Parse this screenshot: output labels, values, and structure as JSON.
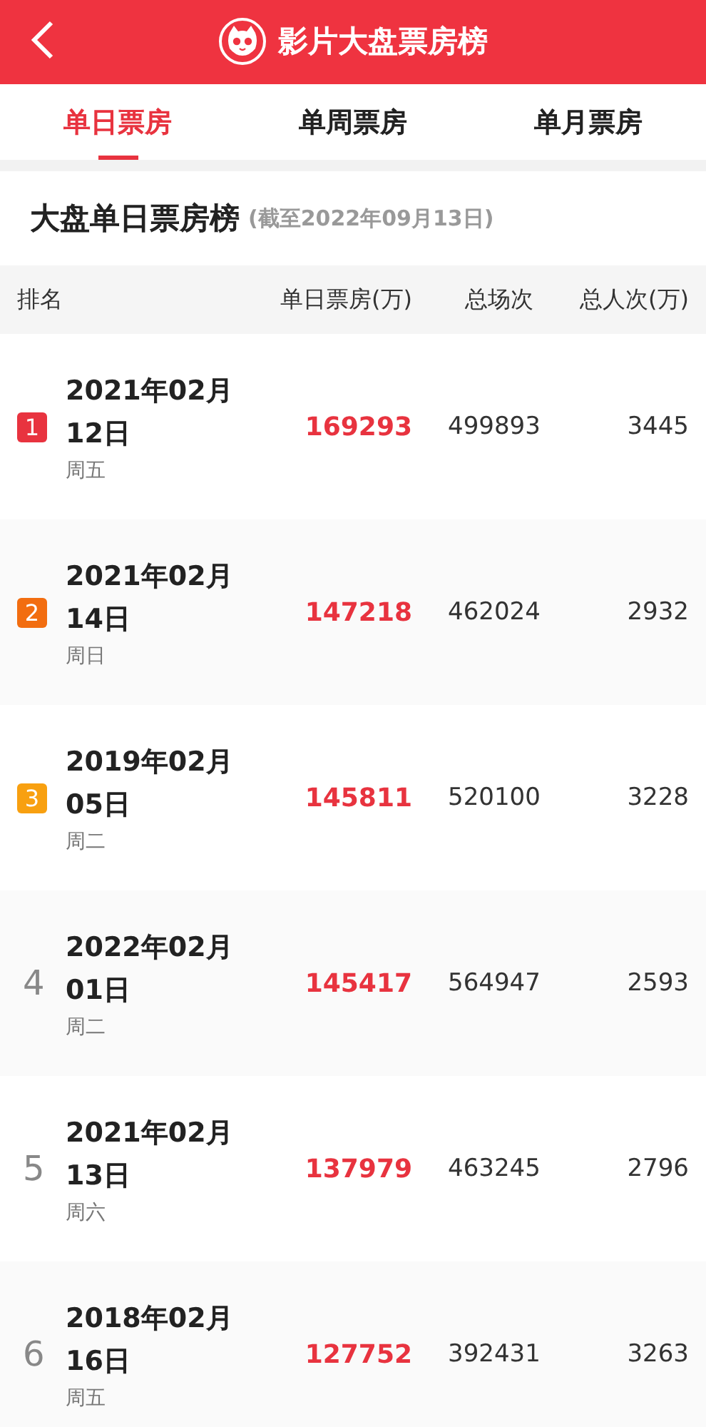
{
  "header": {
    "title": "影片大盘票房榜"
  },
  "tabs": [
    {
      "label": "单日票房",
      "selected": true
    },
    {
      "label": "单周票房",
      "selected": false
    },
    {
      "label": "单月票房",
      "selected": false
    }
  ],
  "section": {
    "title": "大盘单日票房榜",
    "note": "(截至2022年09月13日)"
  },
  "table": {
    "columns": [
      "排名",
      "单日票房(万)",
      "总场次",
      "总人次(万)"
    ],
    "rows": [
      {
        "rank": "1",
        "color": "#e8333f",
        "date": "2021年02月12日",
        "weekday": "周五",
        "box_office": "169293",
        "shows": "499893",
        "viewers": "3445"
      },
      {
        "rank": "2",
        "color": "#f26d10",
        "date": "2021年02月14日",
        "weekday": "周日",
        "box_office": "147218",
        "shows": "462024",
        "viewers": "2932"
      },
      {
        "rank": "3",
        "color": "#f8a010",
        "date": "2019年02月05日",
        "weekday": "周二",
        "box_office": "145811",
        "shows": "520100",
        "viewers": "3228"
      },
      {
        "rank": "4",
        "date": "2022年02月01日",
        "weekday": "周二",
        "box_office": "145417",
        "shows": "564947",
        "viewers": "2593"
      },
      {
        "rank": "5",
        "date": "2021年02月13日",
        "weekday": "周六",
        "box_office": "137979",
        "shows": "463245",
        "viewers": "2796"
      },
      {
        "rank": "6",
        "date": "2018年02月16日",
        "weekday": "周五",
        "box_office": "127752",
        "shows": "392431",
        "viewers": "3263"
      }
    ]
  }
}
